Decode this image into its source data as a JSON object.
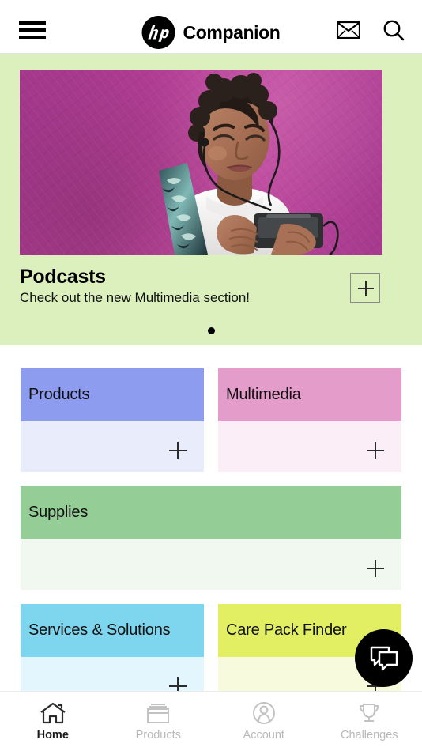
{
  "header": {
    "menu_icon": "hamburger-menu-icon",
    "logo_text": "hp",
    "brand_name": "Companion",
    "mail_icon": "envelope-icon",
    "search_icon": "search-icon"
  },
  "hero": {
    "background_color": "#dcf0bd",
    "image_alt": "woman-with-earbuds-using-phone",
    "title": "Podcasts",
    "subtitle": "Check out the new Multimedia section!",
    "expand_icon": "plus-icon",
    "dots": [
      {
        "active": true
      }
    ]
  },
  "tiles": [
    {
      "label": "Products",
      "header_color": "#8e9cf0",
      "body_color": "#e9ecfa",
      "width": "half",
      "expand_icon": "plus-icon"
    },
    {
      "label": "Multimedia",
      "header_color": "#e49ccb",
      "body_color": "#fbeef6",
      "width": "half",
      "expand_icon": "plus-icon"
    },
    {
      "label": "Supplies",
      "header_color": "#95cd96",
      "body_color": "#f0f8f0",
      "width": "full",
      "expand_icon": "plus-icon"
    },
    {
      "label": "Services & Solutions",
      "header_color": "#7dd5ee",
      "body_color": "#e3f6fd",
      "width": "half",
      "expand_icon": "plus-icon"
    },
    {
      "label": "Care Pack Finder",
      "header_color": "#e3ef63",
      "body_color": "#f8fade",
      "width": "half",
      "expand_icon": "plus-icon"
    }
  ],
  "chat_button": {
    "icon": "chat-bubbles-icon",
    "color": "#000000"
  },
  "bottom_nav": {
    "active_index": 0,
    "items": [
      {
        "label": "Home",
        "icon": "home-icon"
      },
      {
        "label": "Products",
        "icon": "boxes-icon"
      },
      {
        "label": "Account",
        "icon": "person-circle-icon"
      },
      {
        "label": "Challenges",
        "icon": "trophy-icon"
      }
    ]
  }
}
